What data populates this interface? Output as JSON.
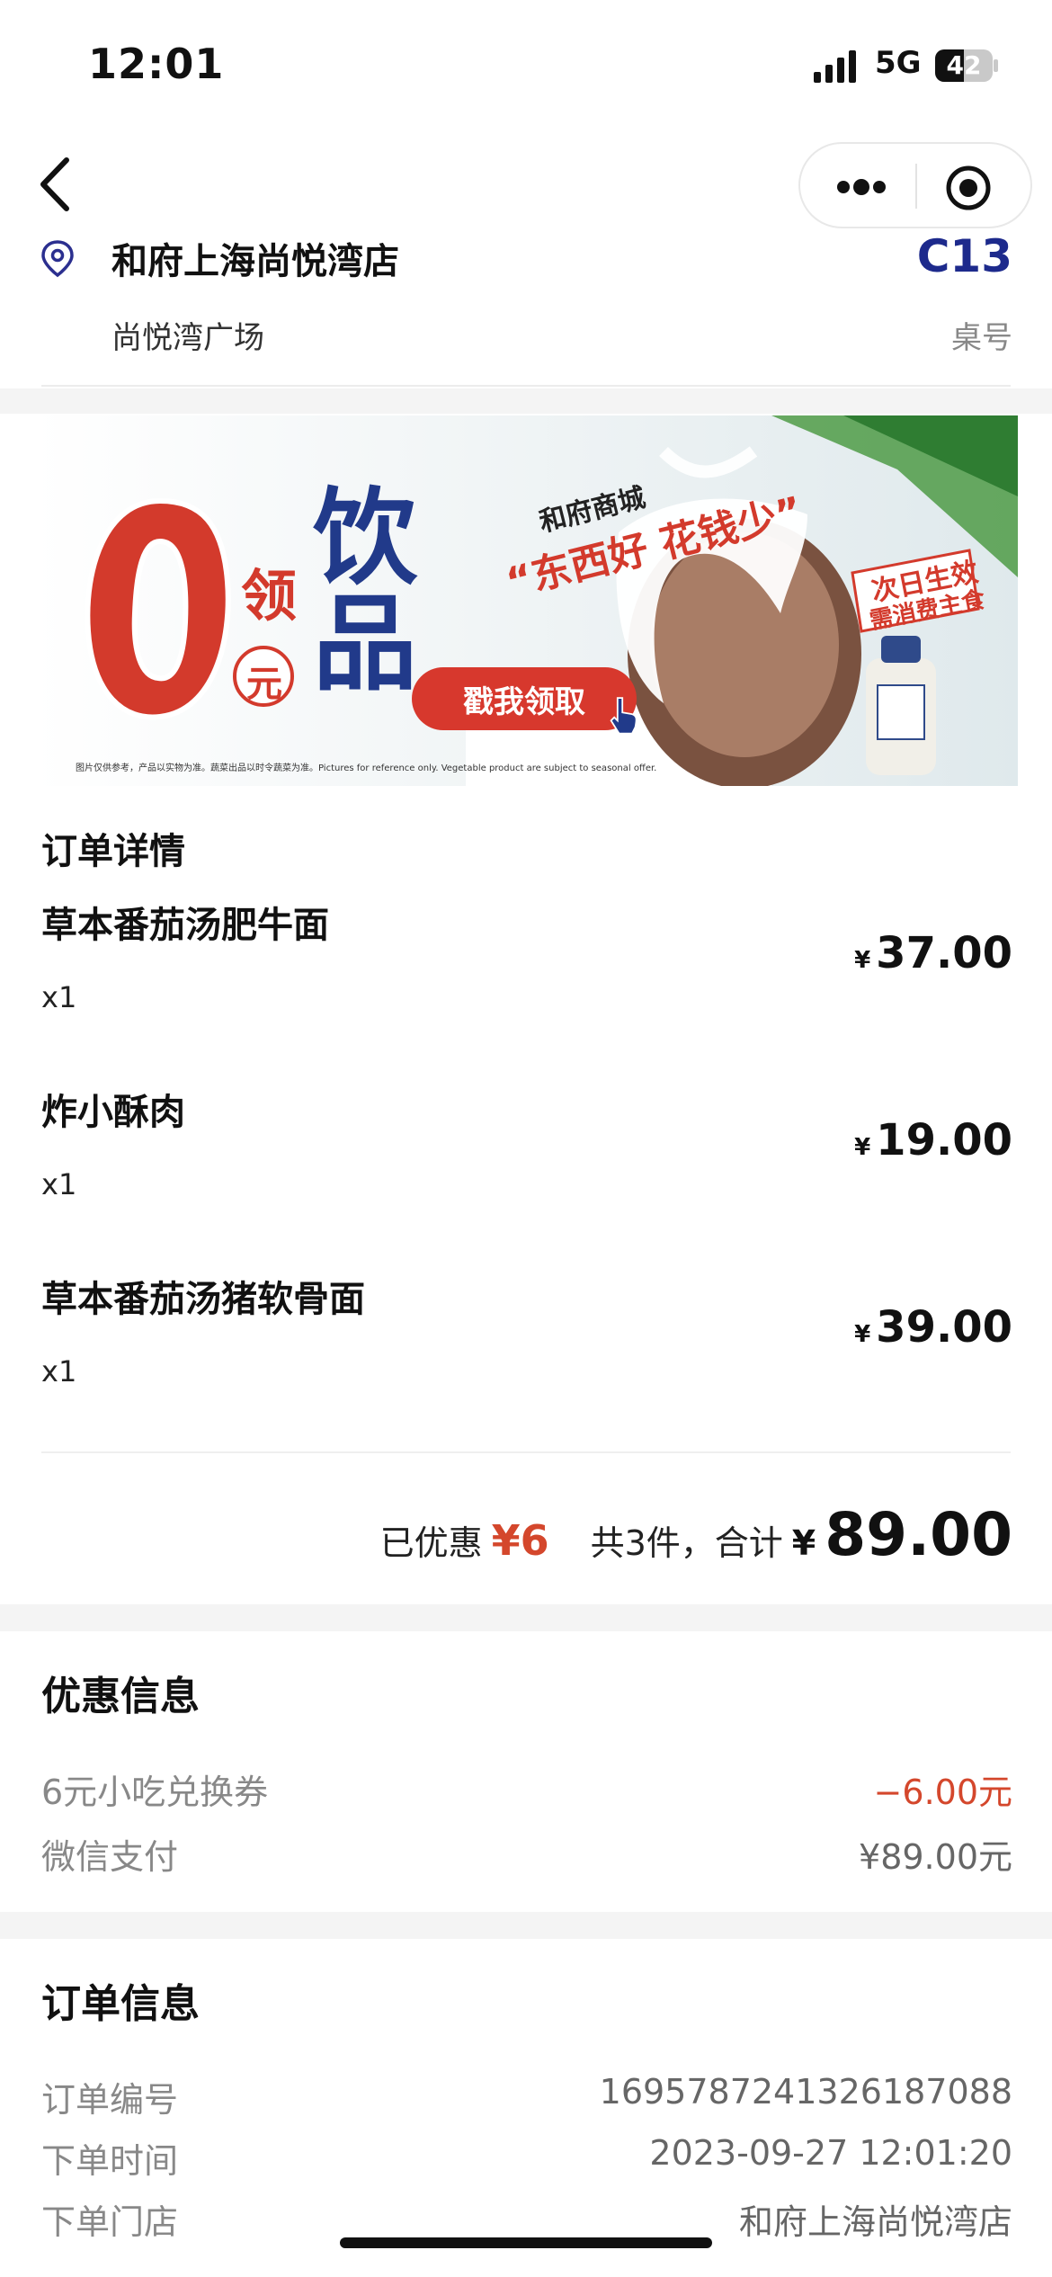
{
  "status_bar": {
    "time": "12:01",
    "network": "5G",
    "battery": "42"
  },
  "store": {
    "name": "和府上海尚悦湾店",
    "subtitle": "尚悦湾广场",
    "table_number": "C13",
    "table_label": "桌号"
  },
  "banner": {
    "zero": "0",
    "yuan": "元",
    "ling": "领",
    "drink": "饮品",
    "brand": "和府商城",
    "slogan": "“东西好 花钱少”",
    "button": "戳我领取",
    "badge_line1": "次日生效",
    "badge_line2": "需消费主食",
    "fine_print": "图片仅供参考，产品以实物为准。蔬菜出品以时令蔬菜为准。Pictures for reference only. Vegetable product are subject to seasonal offer."
  },
  "order": {
    "title": "订单详情",
    "currency": "¥",
    "items": [
      {
        "name": "草本番茄汤肥牛面",
        "qty": "x1",
        "price": "37.00"
      },
      {
        "name": "炸小酥肉",
        "qty": "x1",
        "price": "19.00"
      },
      {
        "name": "草本番茄汤猪软骨面",
        "qty": "x1",
        "price": "39.00"
      }
    ],
    "summary": {
      "discount_label": "已优惠",
      "discount_value": "¥6",
      "count_label": "共3件，合计",
      "total_currency": "¥",
      "total": "89.00"
    }
  },
  "discounts": {
    "title": "优惠信息",
    "rows": [
      {
        "label": "6元小吃兑换券",
        "value": "−6.00元"
      },
      {
        "label": "微信支付",
        "value": "¥89.00元"
      }
    ]
  },
  "order_info": {
    "title": "订单信息",
    "rows": [
      {
        "label": "订单编号",
        "value": "1695787241326187088"
      },
      {
        "label": "下单时间",
        "value": "2023-09-27 12:01:20"
      },
      {
        "label": "下单门店",
        "value": "和府上海尚悦湾店"
      }
    ]
  },
  "colors": {
    "accent_red": "#d4472c",
    "table_blue": "#1d2a8c"
  }
}
